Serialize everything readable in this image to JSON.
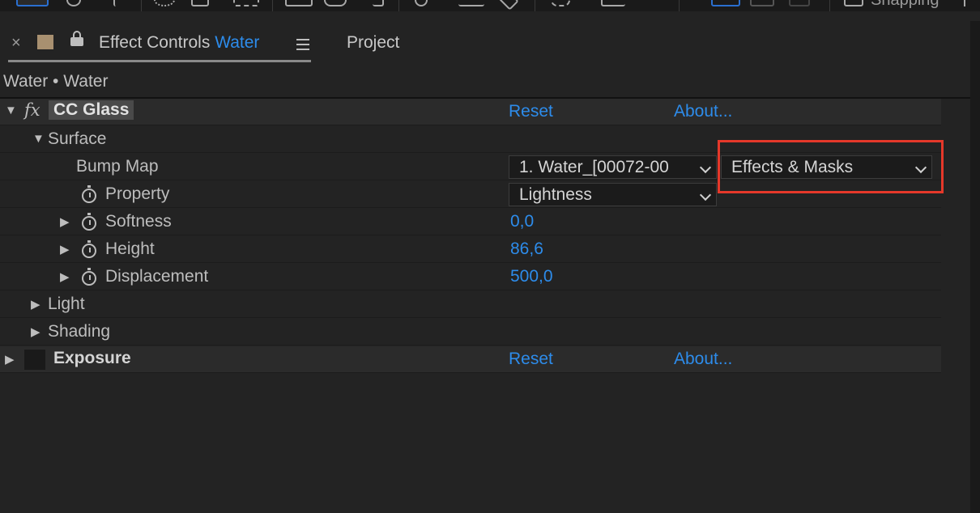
{
  "toolbar": {
    "snapping_label": "Snapping"
  },
  "tabs": {
    "close_glyph": "×",
    "effect_controls_label": "Effect Controls",
    "effect_controls_layer": "Water",
    "project_label": "Project"
  },
  "breadcrumb": "Water • Water",
  "effects": [
    {
      "name": "CC Glass",
      "reset": "Reset",
      "about": "About..."
    },
    {
      "name": "Exposure",
      "reset": "Reset",
      "about": "About..."
    }
  ],
  "groups": {
    "surface": "Surface",
    "light": "Light",
    "shading": "Shading"
  },
  "properties": {
    "bump_map": {
      "label": "Bump Map",
      "layer_value": "1. Water_[00072-00",
      "source_value": "Effects & Masks"
    },
    "property": {
      "label": "Property",
      "value": "Lightness"
    },
    "softness": {
      "label": "Softness",
      "value": "0,0"
    },
    "height": {
      "label": "Height",
      "value": "86,6"
    },
    "displacement": {
      "label": "Displacement",
      "value": "500,0"
    }
  },
  "colors": {
    "background": "#232323",
    "accent_blue": "#2d8ceb",
    "highlight_red": "#e5382a",
    "swatch": "#a89070"
  },
  "icons": [
    "select-tool-icon",
    "hand-tool-icon",
    "zoom-tool-icon",
    "lock-icon",
    "hamburger-menu-icon",
    "stopwatch-icon",
    "fx-icon",
    "chevron-down-icon",
    "disclosure-triangle-icon"
  ]
}
